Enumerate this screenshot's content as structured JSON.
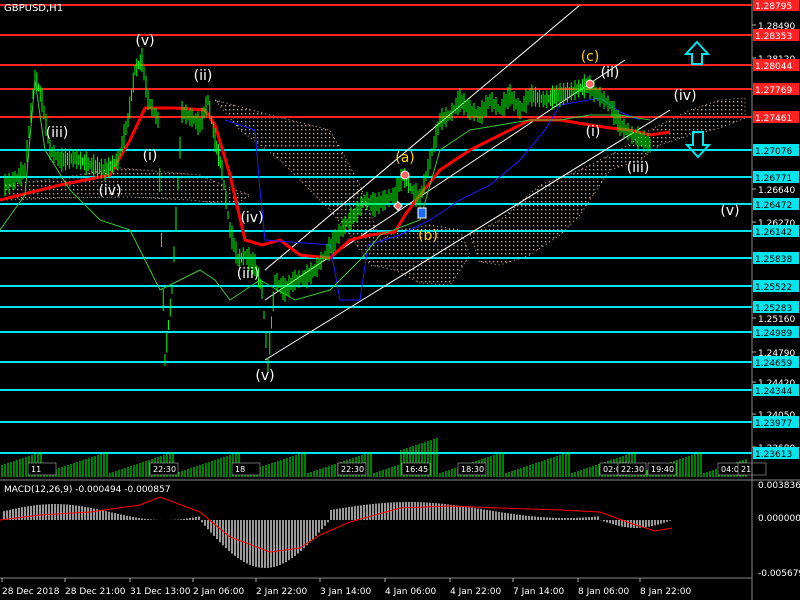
{
  "window": {
    "title": "GBPUSD,H1",
    "macd_title": "MACD(12,26,9) -0.000494 -0.000857"
  },
  "colors": {
    "background": "#000000",
    "candle": "#00ff00",
    "ma_red": "#ff0000",
    "cloud": "#d8a98a",
    "kijun_blue": "#1a1aff",
    "resistance": "#ff2222",
    "support": "#00e5ee",
    "channel": "#ffffff",
    "wave_label": "#ffffff",
    "wave_label_gold": "#ffd400",
    "macd_hist": "#c0c0c0",
    "macd_signal": "#ff0000"
  },
  "price_scale": [
    {
      "text": "1.28795",
      "style": "red"
    },
    {
      "text": "1.28490",
      "style": "plain"
    },
    {
      "text": "1.28353",
      "style": "red"
    },
    {
      "text": "1.28120",
      "style": "plain"
    },
    {
      "text": "1.28044",
      "style": "red"
    },
    {
      "text": "1.27769",
      "style": "red"
    },
    {
      "text": "1.27461",
      "style": "red"
    },
    {
      "text": "1.27076",
      "style": "cyan"
    },
    {
      "text": "1.26771",
      "style": "cyan"
    },
    {
      "text": "1.26640",
      "style": "plain"
    },
    {
      "text": "1.26472",
      "style": "cyan"
    },
    {
      "text": "1.26270",
      "style": "plain"
    },
    {
      "text": "1.26142",
      "style": "cyan"
    },
    {
      "text": "1.25838",
      "style": "cyan"
    },
    {
      "text": "1.25522",
      "style": "cyan"
    },
    {
      "text": "1.25283",
      "style": "cyan"
    },
    {
      "text": "1.25160",
      "style": "plain"
    },
    {
      "text": "1.24989",
      "style": "cyan"
    },
    {
      "text": "1.24790",
      "style": "plain"
    },
    {
      "text": "1.24659",
      "style": "cyan"
    },
    {
      "text": "1.24420",
      "style": "plain"
    },
    {
      "text": "1.24344",
      "style": "cyan"
    },
    {
      "text": "1.24050",
      "style": "plain"
    },
    {
      "text": "1.23977",
      "style": "cyan"
    },
    {
      "text": "1.23680",
      "style": "plain"
    },
    {
      "text": "1.23613",
      "style": "cyan"
    }
  ],
  "macd_scale": [
    "0.003836",
    "0.000000",
    "-0.005679"
  ],
  "time_labels": [
    "28 Dec 2018",
    "28 Dec 21:00",
    "31 Dec 13:00",
    "2 Jan 06:00",
    "2 Jan 22:00",
    "3 Jan 14:00",
    "4 Jan 06:00",
    "4 Jan 22:00",
    "7 Jan 14:00",
    "8 Jan 06:00",
    "8 Jan 22:00"
  ],
  "session_marks": [
    "11",
    "22:30",
    "18",
    "22:30",
    "16:45",
    "18:30",
    "02:01",
    "22:30",
    "19:40",
    "04:00",
    "21"
  ],
  "wave_labels": [
    {
      "text": "(v)",
      "style": "white"
    },
    {
      "text": "(ii)",
      "style": "white"
    },
    {
      "text": "(iii)",
      "style": "white"
    },
    {
      "text": "(i)",
      "style": "white"
    },
    {
      "text": "(iv)",
      "style": "white"
    },
    {
      "text": "(iv)",
      "style": "white"
    },
    {
      "text": "(iii)",
      "style": "white"
    },
    {
      "text": "(v)",
      "style": "white"
    },
    {
      "text": "(a)",
      "style": "gold"
    },
    {
      "text": "(b)",
      "style": "gold"
    },
    {
      "text": "(c)",
      "style": "gold"
    },
    {
      "text": "(ii)",
      "style": "white"
    },
    {
      "text": "(i)",
      "style": "white"
    },
    {
      "text": "(iv)",
      "style": "white"
    },
    {
      "text": "(iii)",
      "style": "white"
    },
    {
      "text": "(v)",
      "style": "white"
    }
  ],
  "arrows": [
    {
      "name": "up-arrow-icon",
      "direction": "up"
    },
    {
      "name": "down-arrow-icon",
      "direction": "down"
    }
  ]
}
